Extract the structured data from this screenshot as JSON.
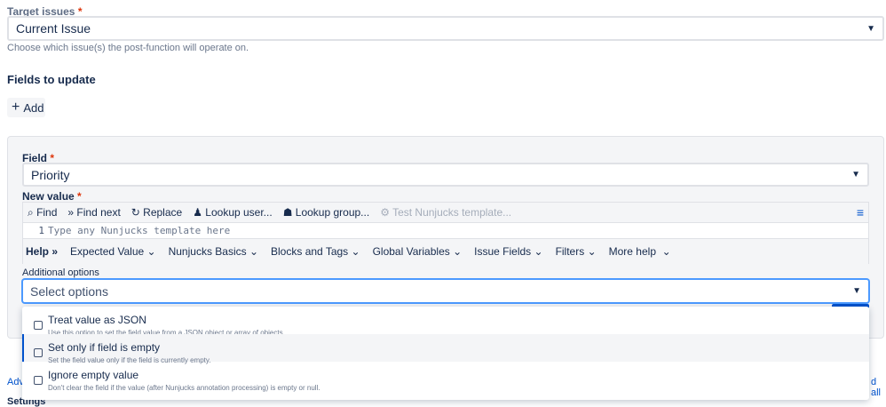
{
  "target": {
    "label": "Target issues",
    "required": "*",
    "value": "Current Issue",
    "help": "Choose which issue(s) the post-function will operate on."
  },
  "fields_title": "Fields to update",
  "add_label": "Add",
  "field": {
    "label": "Field",
    "required": "*",
    "value": "Priority"
  },
  "new_value": {
    "label": "New value",
    "required": "*",
    "toolbar": [
      "Find",
      "Find next",
      "Replace",
      "Lookup user...",
      "Lookup group...",
      "Test Nunjucks template..."
    ],
    "line_number": "1",
    "placeholder": "Type any Nunjucks template here",
    "help_label": "Help",
    "help_menus": [
      "Expected Value",
      "Nunjucks Basics",
      "Blocks and Tags",
      "Global Variables",
      "Issue Fields",
      "Filters",
      "More help"
    ]
  },
  "additional": {
    "label": "Additional options",
    "placeholder": "Select options",
    "options": [
      {
        "title": "Treat value as JSON",
        "desc": "Use this option to set the field value from a JSON object or array of objects."
      },
      {
        "title": "Set only if field is empty",
        "desc": "Set the field value only if the field is currently empty."
      },
      {
        "title": "Ignore empty value",
        "desc": "Don't clear the field if the value (after Nunjucks annotation processing) is empty or null."
      }
    ]
  },
  "links": {
    "left": "Adv",
    "right": "d all"
  },
  "settings": "Settings"
}
